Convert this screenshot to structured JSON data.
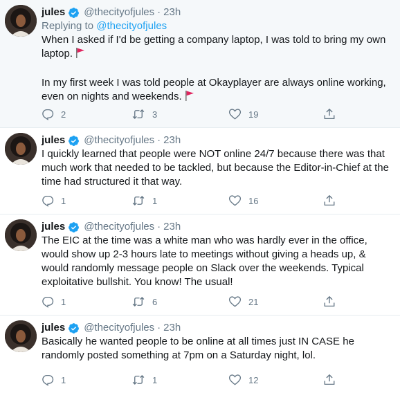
{
  "colors": {
    "accent": "#1da1f2",
    "muted": "#657786",
    "text": "#14171a",
    "flag": "#e0245e",
    "highlight_bg": "#f5f8fa"
  },
  "tweets": [
    {
      "name": "jules",
      "handle": "@thecityofjules",
      "dot": "·",
      "time": "23h",
      "reply_prefix": "Replying to",
      "reply_to": "@thecityofjules",
      "paragraphs": [
        "When I asked if I'd be getting a company laptop, I was told to bring my own laptop.",
        "In my first week I was told people at Okayplayer are always online working, even on nights and weekends."
      ],
      "replies": "2",
      "retweets": "3",
      "likes": "19"
    },
    {
      "name": "jules",
      "handle": "@thecityofjules",
      "dot": "·",
      "time": "23h",
      "text": "I quickly learned that people were NOT online 24/7 because there was that much work that needed to be tackled, but because the Editor-in-Chief at the time had structured it that way.",
      "replies": "1",
      "retweets": "1",
      "likes": "16"
    },
    {
      "name": "jules",
      "handle": "@thecityofjules",
      "dot": "·",
      "time": "23h",
      "text": "The EIC at the time was a white man who was hardly ever in the office, would show up 2-3 hours late to meetings without giving a heads up, & would randomly message people on Slack over the weekends. Typical exploitative bullshit. You know! The usual!",
      "replies": "1",
      "retweets": "6",
      "likes": "21"
    },
    {
      "name": "jules",
      "handle": "@thecityofjules",
      "dot": "·",
      "time": "23h",
      "text": "Basically he wanted people to be online at all times just IN CASE he randomly posted something at 7pm on a Saturday night, lol.",
      "replies": "1",
      "retweets": "1",
      "likes": "12"
    }
  ]
}
